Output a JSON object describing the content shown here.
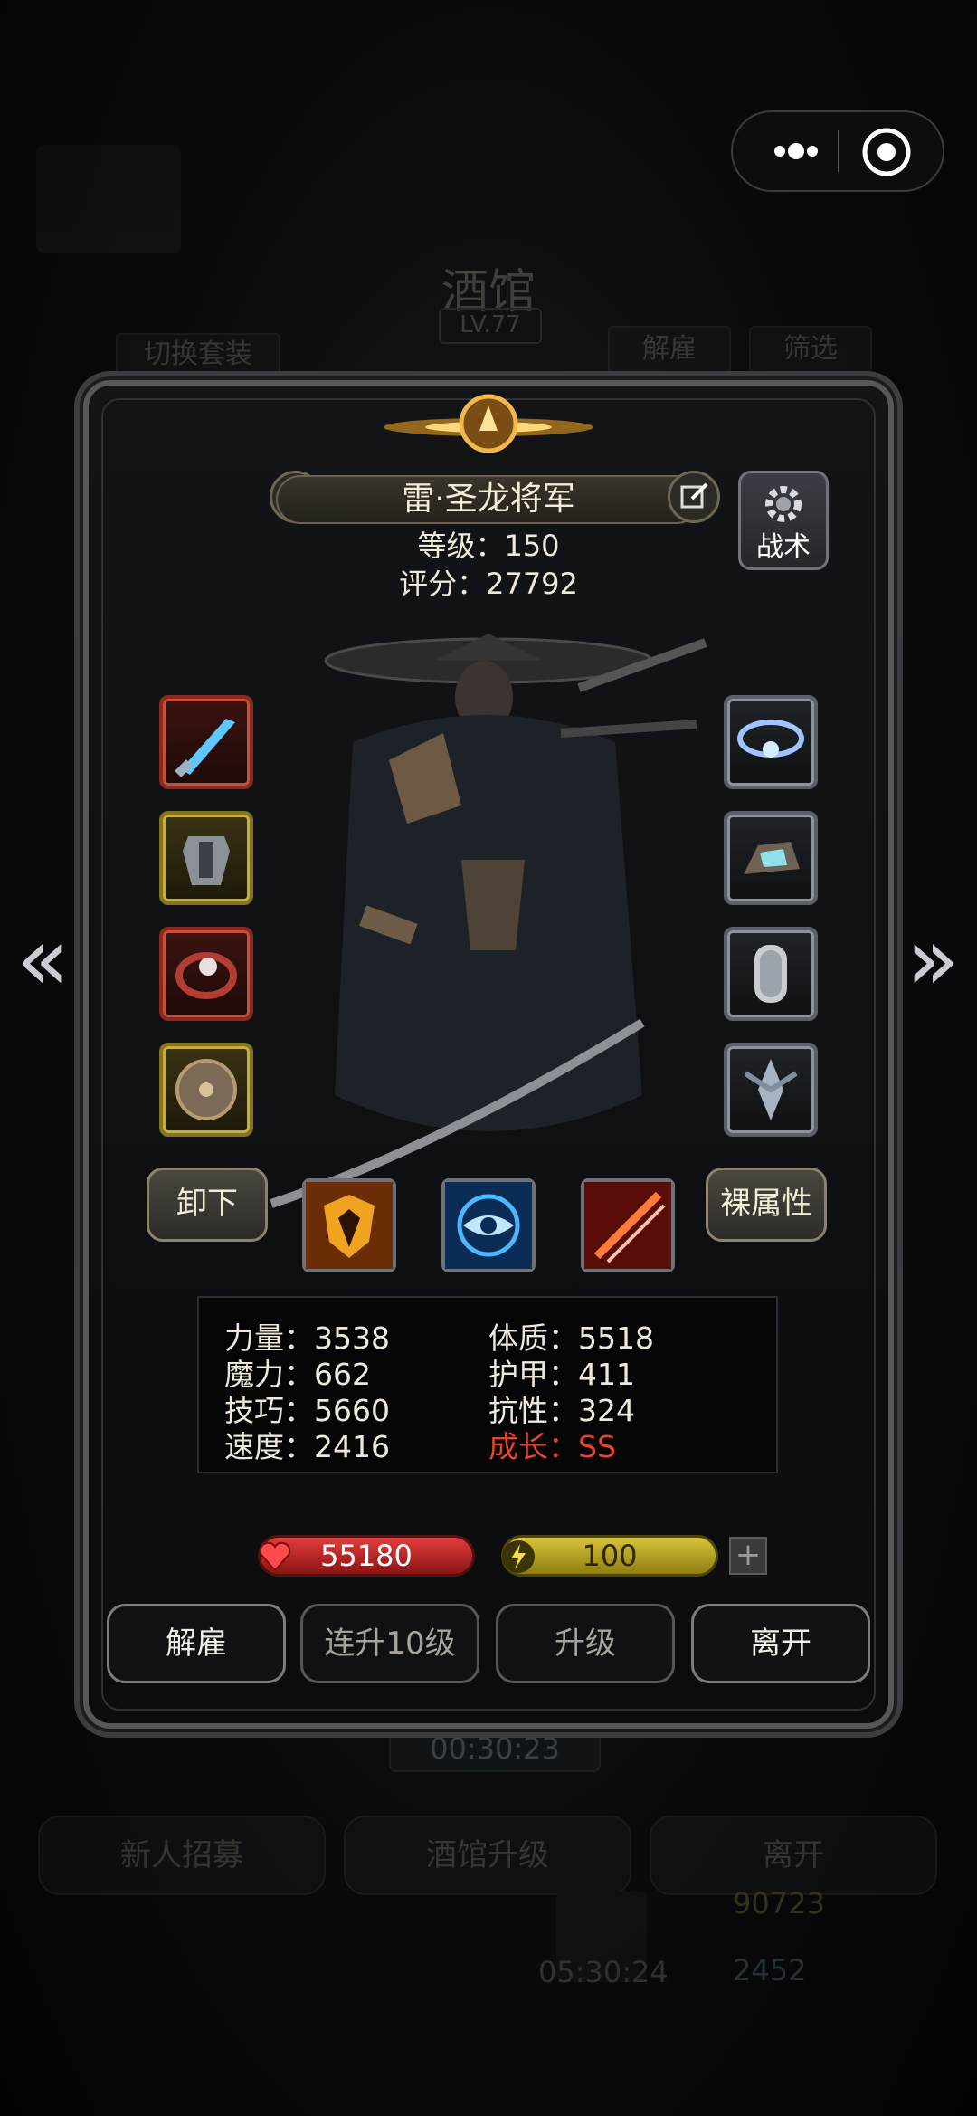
{
  "background": {
    "title": "酒馆",
    "level": "LV.77",
    "switch_outfit": "切换套装",
    "dismiss": "解雇",
    "filter": "筛选",
    "timer_top": "00:30:23",
    "bottom_buttons": [
      "新人招募",
      "酒馆升级",
      "离开"
    ],
    "timer_bottom": "05:30:24",
    "resource_1": "90723",
    "resource_2": "2452"
  },
  "capsule": {
    "menu_icon": "more-dots-icon",
    "close_icon": "target-close-icon"
  },
  "hero": {
    "name": "雷·圣龙将军",
    "level_line": "等级：150",
    "score_line": "评分：27792",
    "tactics_label": "战术"
  },
  "equipment": {
    "left": [
      "ice-sword-icon",
      "armor-icon",
      "ring-icon",
      "shield-icon"
    ],
    "right": [
      "amulet-icon",
      "gem-icon",
      "chainmail-icon",
      "emblem-icon"
    ]
  },
  "skills": [
    "fire-shield-icon",
    "eye-icon",
    "slash-icon"
  ],
  "unequip_label": "卸下",
  "raw_attr_label": "裸属性",
  "stats": {
    "strength": "力量：3538",
    "constitution": "体质：5518",
    "magic": "魔力：662",
    "armor": "护甲：411",
    "skill": "技巧：5660",
    "resistance": "抗性：324",
    "speed": "速度：2416",
    "growth": "成长：SS"
  },
  "hp_value": "55180",
  "energy_value": "100",
  "plus_label": "+",
  "actions": {
    "dismiss": "解雇",
    "level_up_10": "连升10级",
    "level_up": "升级",
    "leave": "离开"
  },
  "colors": {
    "growth": "#e0452e",
    "hp": "#d93434",
    "energy": "#d4be35"
  }
}
